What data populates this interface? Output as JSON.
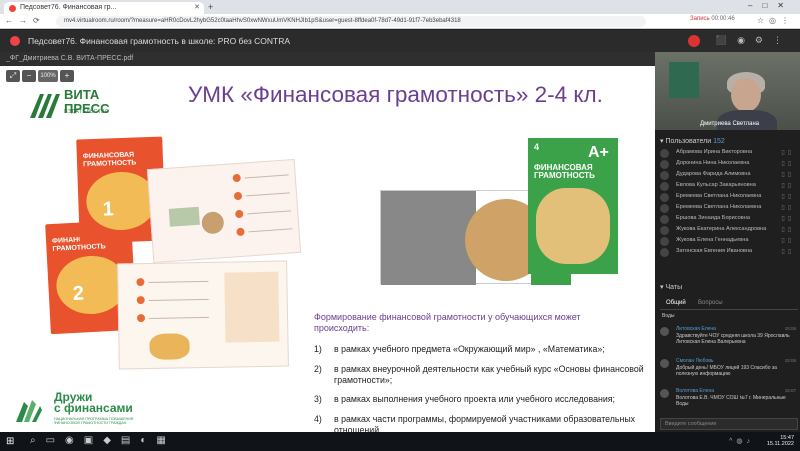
{
  "browser": {
    "tab_title": "Педсовет76. Финансовая гр...",
    "url": "mv4.virtualroom.ru/room/?measure=aHR0cDovL2hybG52c0taaHhvS0xwNWxuUmVKNHJIb1pS&user=guest-8ffdea0f-78d7-49d1-91f7-7eb3ebaf4318",
    "rec_label": "Запись",
    "rec_time": "00:00:46"
  },
  "app": {
    "title": "Педсовет76. Финансовая грамотность в школе: PRO без CONTRA"
  },
  "document": {
    "name": "_ФГ_Дмитриева С.В. ВИТА-ПРЕСС.pdf",
    "zoom_label": "100%"
  },
  "slide": {
    "title": "УМК «Финансовая грамотность» 2-4 кл.",
    "publisher_word": "ВИТА\nПРЕСС",
    "publisher_sub": "ИЗДАТЕЛЬСТВО",
    "book_title": "ФИНАНСОВАЯ\nГРАМОТНОСТЬ",
    "book1_grade": "1",
    "book2_grade": "2",
    "book3_grade": "4",
    "grade_mark": "А+",
    "formation_heading": "Формирование финансовой грамотности у обучающихся может происходить:",
    "list": [
      {
        "n": "1)",
        "text": "в рамках учебного предмета «Окружающий мир» , «Математика»;"
      },
      {
        "n": "2)",
        "text": "в рамках внеурочной деятельности как учебный курс «Основы финансовой грамотности»;"
      },
      {
        "n": "3)",
        "text": "в рамках выполнения учебного проекта или учебного исследования;"
      },
      {
        "n": "4)",
        "text": "в рамках части программы, формируемой участниками образовательных отношений"
      }
    ],
    "druzhi_word": "Дружи\nс финансами",
    "druzhi_sub": "НАЦИОНАЛЬНАЯ ПРОГРАММА ПОВЫШЕНИЯ ФИНАНСОВОЙ ГРАМОТНОСТИ ГРАЖДАН"
  },
  "video": {
    "speaker_name": "Дмитриева Светлана"
  },
  "users": {
    "header": "Пользователи",
    "count": "152",
    "list": [
      "Абрамова Ирина Викторовна",
      "Доронина Нина Николаевна",
      "Дударова Фарида Алимовна",
      "Евлова Кульсар Закарьяновна",
      "Еремеева Светлана Николаевна",
      "Еремеева Светлана Николаевна",
      "Ершова Зинаида Борисовна",
      "Жукова Екатерина Александровна",
      "Жукова Елена Геннадьевна",
      "Затонская Евгения Ивановна"
    ]
  },
  "chat": {
    "header": "Чаты",
    "tab_general": "Общий",
    "tab_questions": "Вопросы",
    "messages": [
      {
        "author": "Воды",
        "time": "",
        "text": ""
      },
      {
        "author": "Литовская Елена",
        "time": "15:06",
        "text": "Здравствуйте ЧОУ средняя школа 39 Ярославль Литовская Елена Валерьевна"
      },
      {
        "author": "Смолан Любовь",
        "time": "15:06",
        "text": "Добрый день! МБОУ лицей 193 Спасибо за полезную информацию"
      },
      {
        "author": "Волотова Елена",
        "time": "15:07",
        "text": "Волотова Е.В. ЧМОУ СОШ №7 г. Минеральные Воды"
      }
    ],
    "input_placeholder": "Введите сообщение"
  },
  "taskbar": {
    "time": "15:47",
    "date": "15.11.2022"
  }
}
